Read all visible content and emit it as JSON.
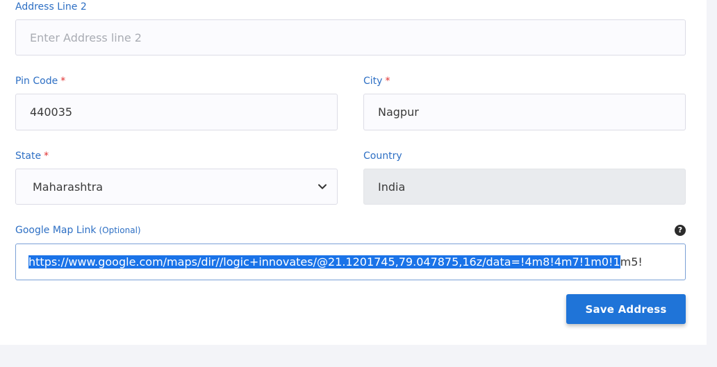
{
  "form": {
    "address_line2": {
      "label": "Address Line 2",
      "placeholder": "Enter Address line 2",
      "value": ""
    },
    "pin_code": {
      "label": "Pin Code",
      "required_mark": "*",
      "value": "440035"
    },
    "city": {
      "label": "City",
      "required_mark": "*",
      "value": "Nagpur"
    },
    "state": {
      "label": "State",
      "required_mark": "*",
      "selected": "Maharashtra"
    },
    "country": {
      "label": "Country",
      "value": "India"
    },
    "map_link": {
      "label": "Google Map Link",
      "optional_note": "(Optional)",
      "value_selected": "https://www.google.com/maps/dir//logic+innovates/@21.1201745,79.047875,16z/data=!4m8!4m7!1m0!1",
      "value_rest": "m5!",
      "help_icon": "question-circle-icon"
    },
    "save_label": "Save Address"
  },
  "colors": {
    "label": "#2d6fc4",
    "required": "#e03131",
    "button": "#1f74d8",
    "selection": "#1a73e8"
  }
}
